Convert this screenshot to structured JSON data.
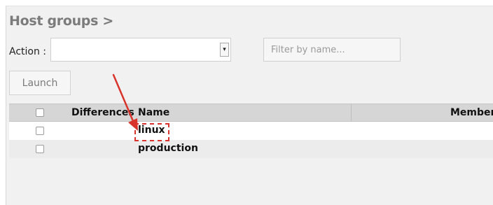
{
  "header": {
    "title": "Host groups >"
  },
  "toolbar": {
    "action_label": "Action :",
    "action_selected": "",
    "filter_placeholder": "Filter by name...",
    "launch_label": "Launch"
  },
  "table": {
    "columns": [
      "",
      "Differences",
      "Name",
      "Members"
    ],
    "rows": [
      {
        "name": "linux",
        "checked": false
      },
      {
        "name": "production",
        "checked": false
      }
    ]
  },
  "annotation": {
    "color": "#d8342c",
    "target": "table.rows.0.name"
  }
}
